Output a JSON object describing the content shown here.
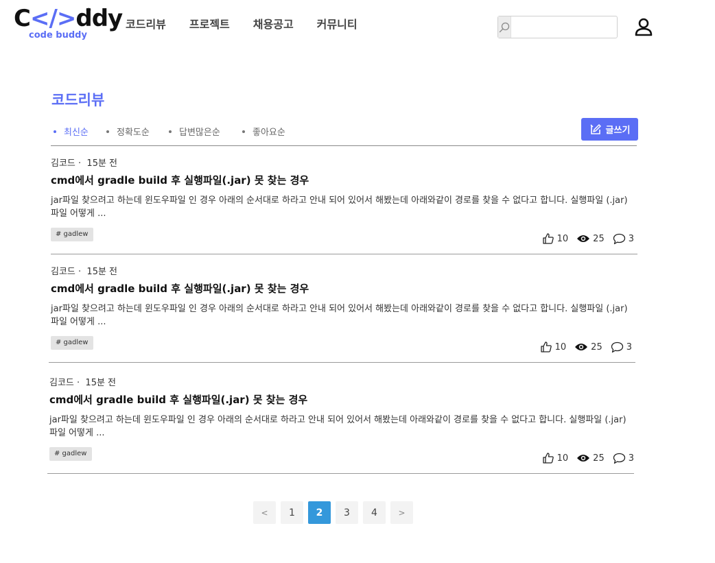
{
  "header": {
    "logo_main_pre": "C",
    "logo_slash": "</>",
    "logo_main_post": "ddy",
    "logo_sub": "code buddy",
    "nav": [
      "코드리뷰",
      "프로젝트",
      "채용공고",
      "커뮤니티"
    ],
    "search": {
      "value": "",
      "placeholder": ""
    }
  },
  "section": {
    "title": "코드리뷰",
    "sort_tabs": [
      "최신순",
      "정확도순",
      "답변많은순",
      "좋아요순"
    ],
    "active_sort": 0,
    "write_label": "글쓰기"
  },
  "posts": [
    {
      "author": "김코드",
      "time": "15분 전",
      "title": "cmd에서 gradle build 후 실행파일(.jar) 못 찾는 경우",
      "body": "jar파일 찾으려고 하는데 윈도우파일 인 경우 아래의 순서대로 하라고 안내 되어 있어서 해봤는데 아래와같이 경로를 찾을 수 없다고 합니다. 실행파일 (.jar) 파일 어떻게 ...",
      "tag": "# gadlew",
      "likes": "10",
      "views": "25",
      "comments": "3"
    },
    {
      "author": "김코드",
      "time": "15분 전",
      "title": "cmd에서 gradle build 후 실행파일(.jar) 못 찾는 경우",
      "body": "jar파일 찾으려고 하는데 윈도우파일 인 경우 아래의 순서대로 하라고 안내 되어 있어서 해봤는데 아래와같이 경로를 찾을 수 없다고 합니다. 실행파일 (.jar) 파일 어떻게 ...",
      "tag": "# gadlew",
      "likes": "10",
      "views": "25",
      "comments": "3"
    },
    {
      "author": "김코드",
      "time": "15분 전",
      "title": "cmd에서 gradle build 후 실행파일(.jar) 못 찾는 경우",
      "body": "jar파일 찾으려고 하는데 윈도우파일 인 경우 아래의 순서대로 하라고 안내 되어 있어서 해봤는데 아래와같이 경로를 찾을 수 없다고 합니다. 실행파일 (.jar) 파일 어떻게 ...",
      "tag": "# gadlew",
      "likes": "10",
      "views": "25",
      "comments": "3"
    }
  ],
  "pagination": {
    "prev": "<",
    "pages": [
      "1",
      "2",
      "3",
      "4"
    ],
    "current": "2",
    "next": ">"
  },
  "colors": {
    "accent": "#5b6ef5",
    "page_active": "#3498db"
  }
}
